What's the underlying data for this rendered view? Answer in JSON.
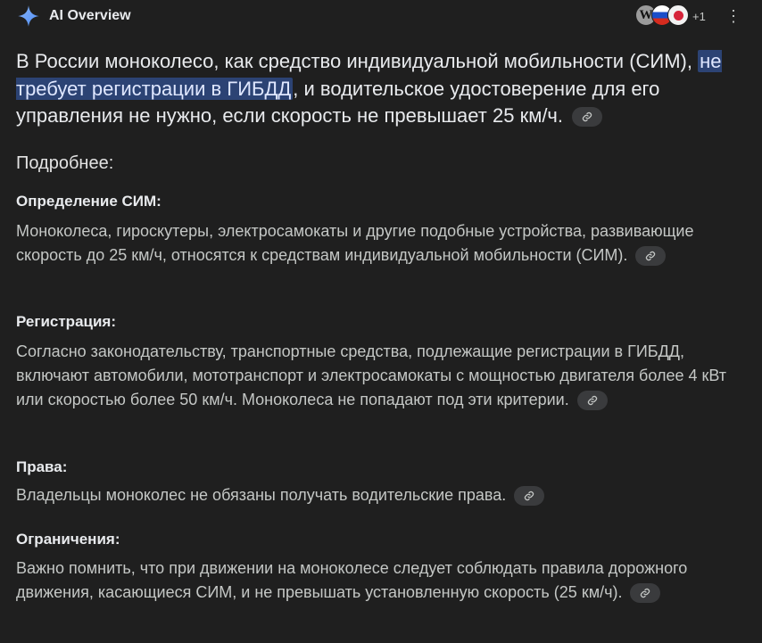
{
  "header": {
    "title": "AI Overview",
    "sources_more": "+1",
    "sources": [
      "W"
    ],
    "icons": [
      "sparkle-icon",
      "more-vert-icon",
      "link-icon"
    ]
  },
  "summary": {
    "pre": "В России моноколесо, как средство индивидуальной мобильности (СИМ), ",
    "highlight": "не требует регистрации в ГИБДД",
    "post": ", и водительское удостоверение для его управления не нужно, если скорость не превышает 25 км/ч."
  },
  "details_label": "Подробнее:",
  "sections": [
    {
      "title": "Определение СИМ:",
      "body": "Моноколеса, гироскутеры, электросамокаты и другие подобные устройства, развивающие скорость до 25 км/ч, относятся к средствам индивидуальной мобильности (СИМ)."
    },
    {
      "title": "Регистрация:",
      "body": "Согласно законодательству, транспортные средства, подлежащие регистрации в ГИБДД, включают автомобили, мототранспорт и электросамокаты с мощностью двигателя более 4 кВт или скоростью более 50 км/ч. Моноколеса не попадают под эти критерии."
    },
    {
      "title": "Права:",
      "body": "Владельцы моноколес не обязаны получать водительские права."
    },
    {
      "title": "Ограничения:",
      "body": "Важно помнить, что при движении на моноколесе следует соблюдать правила дорожного движения, касающиеся СИМ, и не превышать установленную скорость (25 км/ч)."
    }
  ],
  "colors": {
    "background": "#1f1f1f",
    "highlight": "#2c4374",
    "accent_blue": "#4c8df6"
  }
}
